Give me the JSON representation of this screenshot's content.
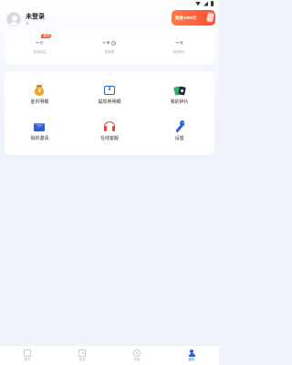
{
  "profile": {
    "title": "未登录",
    "user_id": "ID:"
  },
  "promo": {
    "text": "现金1000元"
  },
  "stats": [
    {
      "value": "--",
      "unit": "元",
      "label": "现金收益",
      "badge": "提现"
    },
    {
      "value": "--",
      "unit": "条",
      "label": "提现券",
      "help": "?"
    },
    {
      "value": "--",
      "unit": "张",
      "label": "我的碎片"
    }
  ],
  "menu": [
    {
      "label": "金币明细",
      "icon": "coin-bag-icon"
    },
    {
      "label": "提现券明细",
      "icon": "withdraw-ticket-icon"
    },
    {
      "label": "我的碎片",
      "icon": "cards-icon"
    },
    {
      "label": "我的邀请",
      "icon": "mail-icon"
    },
    {
      "label": "在线客服",
      "icon": "headset-icon"
    },
    {
      "label": "设置",
      "icon": "wrench-icon"
    }
  ],
  "tabbar": [
    {
      "label": "首页",
      "icon": "home-icon",
      "active": false
    },
    {
      "label": "视频",
      "icon": "video-icon",
      "active": false
    },
    {
      "label": "转盘",
      "icon": "wheel-icon",
      "active": false
    },
    {
      "label": "我的",
      "icon": "user-icon",
      "active": true
    }
  ],
  "colors": {
    "accent": "#2d5fd6",
    "promo": "#ff5a3c",
    "background": "#eef2fb"
  }
}
